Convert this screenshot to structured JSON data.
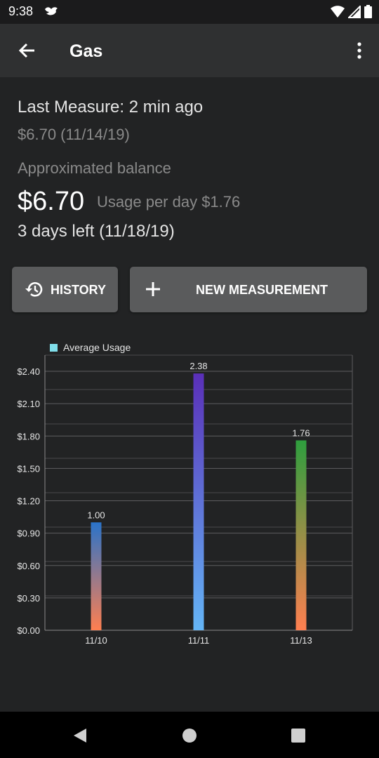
{
  "status_bar": {
    "time": "9:38",
    "icons": [
      "notification-bird-icon",
      "wifi-icon",
      "cell-signal-icon",
      "battery-icon"
    ]
  },
  "app_bar": {
    "title": "Gas",
    "back_icon": "arrow-back-icon",
    "menu_icon": "more-vert-icon"
  },
  "summary": {
    "last_measure": "Last Measure: 2 min ago",
    "last_value": "$6.70 (11/14/19)",
    "approx_label": "Approximated balance",
    "balance": "$6.70",
    "usage_per_day": "Usage per day $1.76",
    "days_left": "3 days left (11/18/19)"
  },
  "actions": {
    "history_label": "HISTORY",
    "history_icon": "history-icon",
    "new_measurement_label": "NEW MEASUREMENT",
    "new_measurement_icon": "add-icon"
  },
  "chart_data": {
    "type": "bar",
    "categories": [
      "11/10",
      "11/11",
      "11/13"
    ],
    "series": [
      {
        "name": "Average Usage",
        "values": [
          1.0,
          2.38,
          1.76
        ]
      }
    ],
    "data_labels": [
      "1.00",
      "2.38",
      "1.76"
    ],
    "y_ticks": [
      "$0.00",
      "$0.30",
      "$0.60",
      "$0.90",
      "$1.20",
      "$1.50",
      "$1.80",
      "$2.10",
      "$2.40"
    ],
    "ylim": [
      0,
      2.55
    ],
    "legend_position": "top-left",
    "legend_color": "#80deea",
    "bar_gradients": [
      [
        "#ff7f50",
        "#2a73c9"
      ],
      [
        "#64b5f6",
        "#5a2fb8"
      ],
      [
        "#ff7f50",
        "#2e9e3e"
      ]
    ],
    "grid": true
  },
  "nav_bar": {
    "icons": [
      "nav-back-icon",
      "nav-home-icon",
      "nav-recents-icon"
    ]
  }
}
